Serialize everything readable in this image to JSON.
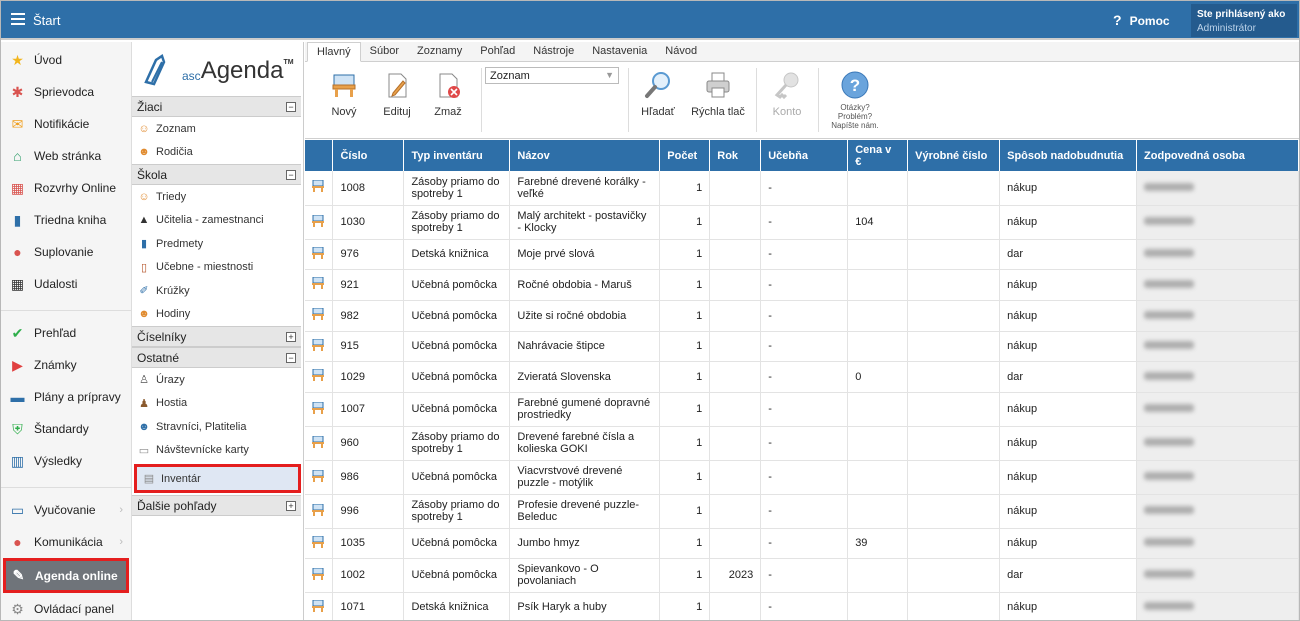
{
  "topbar": {
    "title": "Štart",
    "help_label": "Pomoc",
    "user_line1": "Ste prihlásený ako",
    "user_line2": "Administrátor"
  },
  "nav_main": [
    {
      "name": "nav-uvod",
      "label": "Úvod",
      "icon": "star-icon"
    },
    {
      "name": "nav-sprievodca",
      "label": "Sprievodca",
      "icon": "wand-icon"
    },
    {
      "name": "nav-notifikacie",
      "label": "Notifikácie",
      "icon": "envelope-icon"
    },
    {
      "name": "nav-web-stranka",
      "label": "Web stránka",
      "icon": "house-icon"
    },
    {
      "name": "nav-rozvrhy",
      "label": "Rozvrhy Online",
      "icon": "calendar-icon"
    },
    {
      "name": "nav-triedna-kniha",
      "label": "Triedna kniha",
      "icon": "book-icon"
    },
    {
      "name": "nav-suplovanie",
      "label": "Suplovanie",
      "icon": "person-icon"
    },
    {
      "name": "nav-udalosti",
      "label": "Udalosti",
      "icon": "calendar-dark-icon"
    },
    {
      "name": "nav-prehlad",
      "label": "Prehľad",
      "icon": "check-circle-icon"
    },
    {
      "name": "nav-znamky",
      "label": "Známky",
      "icon": "play-circle-icon"
    },
    {
      "name": "nav-plany",
      "label": "Plány a prípravy",
      "icon": "briefcase-icon"
    },
    {
      "name": "nav-standardy",
      "label": "Štandardy",
      "icon": "shield-check-icon"
    },
    {
      "name": "nav-vysledky",
      "label": "Výsledky",
      "icon": "bar-chart-icon"
    },
    {
      "name": "nav-vyucovanie",
      "label": "Vyučovanie",
      "icon": "open-book-icon"
    },
    {
      "name": "nav-komunikacia",
      "label": "Komunikácia",
      "icon": "people-icon"
    },
    {
      "name": "nav-agenda-online",
      "label": "Agenda online",
      "icon": "agenda-icon"
    },
    {
      "name": "nav-ovladaci-panel",
      "label": "Ovládací panel",
      "icon": "gear-icon"
    }
  ],
  "nav_agenda": {
    "logo_small": "asc",
    "logo_big": "Agenda",
    "logo_tm": "TM",
    "sections": [
      {
        "title": "Žiaci",
        "toggle": "−",
        "items": [
          {
            "label": "Zoznam",
            "icon": "student-icon"
          },
          {
            "label": "Rodičia",
            "icon": "parents-icon"
          }
        ]
      },
      {
        "title": "Škola",
        "toggle": "−",
        "items": [
          {
            "label": "Triedy",
            "icon": "class-icon"
          },
          {
            "label": "Učitelia - zamestnanci",
            "icon": "graduation-cap-icon"
          },
          {
            "label": "Predmety",
            "icon": "subject-book-icon"
          },
          {
            "label": "Učebne - miestnosti",
            "icon": "door-icon"
          },
          {
            "label": "Krúžky",
            "icon": "club-icon"
          },
          {
            "label": "Hodiny",
            "icon": "people-group-icon"
          }
        ]
      },
      {
        "title": "Číselníky",
        "toggle": "+",
        "items": []
      },
      {
        "title": "Ostatné",
        "toggle": "−",
        "items": [
          {
            "label": "Úrazy",
            "icon": "injury-icon"
          },
          {
            "label": "Hostia",
            "icon": "guest-icon"
          },
          {
            "label": "Stravníci, Platitelia",
            "icon": "diners-icon"
          },
          {
            "label": "Návštevnícke karty",
            "icon": "card-icon"
          },
          {
            "label": "Inventár",
            "icon": "inventory-icon"
          }
        ]
      },
      {
        "title": "Ďalšie pohľady",
        "toggle": "+",
        "items": []
      }
    ]
  },
  "tabs": [
    "Hlavný",
    "Súbor",
    "Zoznamy",
    "Pohľad",
    "Nástroje",
    "Nastavenia",
    "Návod"
  ],
  "ribbon": {
    "novy": "Nový",
    "edituj": "Edituj",
    "zmaz": "Zmaž",
    "dropdown": "Zoznam",
    "hladat": "Hľadať",
    "rychla_tlac": "Rýchla tlač",
    "konto": "Konto",
    "help1": "Otázky?",
    "help2": "Problém?",
    "help3": "Napíšte nám."
  },
  "table": {
    "headers": [
      "Číslo",
      "Typ inventáru",
      "Názov",
      "Počet",
      "Rok",
      "Učebňa",
      "Cena v €",
      "Výrobné číslo",
      "Spôsob nadobudnutia",
      "Zodpovedná osoba"
    ],
    "rows": [
      {
        "cislo": "1008",
        "typ": "Zásoby priamo do spotreby 1",
        "nazov": "Farebné drevené korálky - veľké",
        "pocet": "1",
        "rok": "",
        "ucebna": "-",
        "cena": "",
        "vyrobne": "",
        "sposob": "nákup"
      },
      {
        "cislo": "1030",
        "typ": "Zásoby priamo do spotreby 1",
        "nazov": "Malý architekt - postavičky - Klocky",
        "pocet": "1",
        "rok": "",
        "ucebna": "-",
        "cena": "104",
        "vyrobne": "",
        "sposob": "nákup"
      },
      {
        "cislo": "976",
        "typ": "Detská knižnica",
        "nazov": "Moje prvé slová",
        "pocet": "1",
        "rok": "",
        "ucebna": "-",
        "cena": "",
        "vyrobne": "",
        "sposob": "dar"
      },
      {
        "cislo": "921",
        "typ": "Učebná pomôcka",
        "nazov": "Ročné obdobia - Maruš",
        "pocet": "1",
        "rok": "",
        "ucebna": "-",
        "cena": "",
        "vyrobne": "",
        "sposob": "nákup"
      },
      {
        "cislo": "982",
        "typ": "Učebná pomôcka",
        "nazov": "Užite si ročné obdobia",
        "pocet": "1",
        "rok": "",
        "ucebna": "-",
        "cena": "",
        "vyrobne": "",
        "sposob": "nákup"
      },
      {
        "cislo": "915",
        "typ": "Učebná pomôcka",
        "nazov": "Nahrávacie štipce",
        "pocet": "1",
        "rok": "",
        "ucebna": "-",
        "cena": "",
        "vyrobne": "",
        "sposob": "nákup"
      },
      {
        "cislo": "1029",
        "typ": "Učebná pomôcka",
        "nazov": "Zvieratá Slovenska",
        "pocet": "1",
        "rok": "",
        "ucebna": "-",
        "cena": "0",
        "vyrobne": "",
        "sposob": "dar"
      },
      {
        "cislo": "1007",
        "typ": "Učebná pomôcka",
        "nazov": "Farebné gumené dopravné prostriedky",
        "pocet": "1",
        "rok": "",
        "ucebna": "-",
        "cena": "",
        "vyrobne": "",
        "sposob": "nákup"
      },
      {
        "cislo": "960",
        "typ": "Zásoby priamo do spotreby 1",
        "nazov": "Drevené farebné čísla a kolieska GOKI",
        "pocet": "1",
        "rok": "",
        "ucebna": "-",
        "cena": "",
        "vyrobne": "",
        "sposob": "nákup"
      },
      {
        "cislo": "986",
        "typ": "Učebná pomôcka",
        "nazov": "Viacvrstvové drevené puzzle - motýlik",
        "pocet": "1",
        "rok": "",
        "ucebna": "-",
        "cena": "",
        "vyrobne": "",
        "sposob": "nákup"
      },
      {
        "cislo": "996",
        "typ": "Zásoby priamo do spotreby 1",
        "nazov": "Profesie drevené puzzle-Beleduc",
        "pocet": "1",
        "rok": "",
        "ucebna": "-",
        "cena": "",
        "vyrobne": "",
        "sposob": "nákup"
      },
      {
        "cislo": "1035",
        "typ": "Učebná pomôcka",
        "nazov": "Jumbo hmyz",
        "pocet": "1",
        "rok": "",
        "ucebna": "-",
        "cena": "39",
        "vyrobne": "",
        "sposob": "nákup"
      },
      {
        "cislo": "1002",
        "typ": "Učebná pomôcka",
        "nazov": "Spievankovo - O povolaniach",
        "pocet": "1",
        "rok": "2023",
        "ucebna": "-",
        "cena": "",
        "vyrobne": "",
        "sposob": "dar"
      },
      {
        "cislo": "1071",
        "typ": "Detská knižnica",
        "nazov": "Psík Haryk a huby",
        "pocet": "1",
        "rok": "",
        "ucebna": "-",
        "cena": "",
        "vyrobne": "",
        "sposob": "nákup"
      }
    ]
  },
  "colors": {
    "topbar": "#2e6fa8",
    "header": "#2e6fa8",
    "highlight": "#e41e1e"
  }
}
